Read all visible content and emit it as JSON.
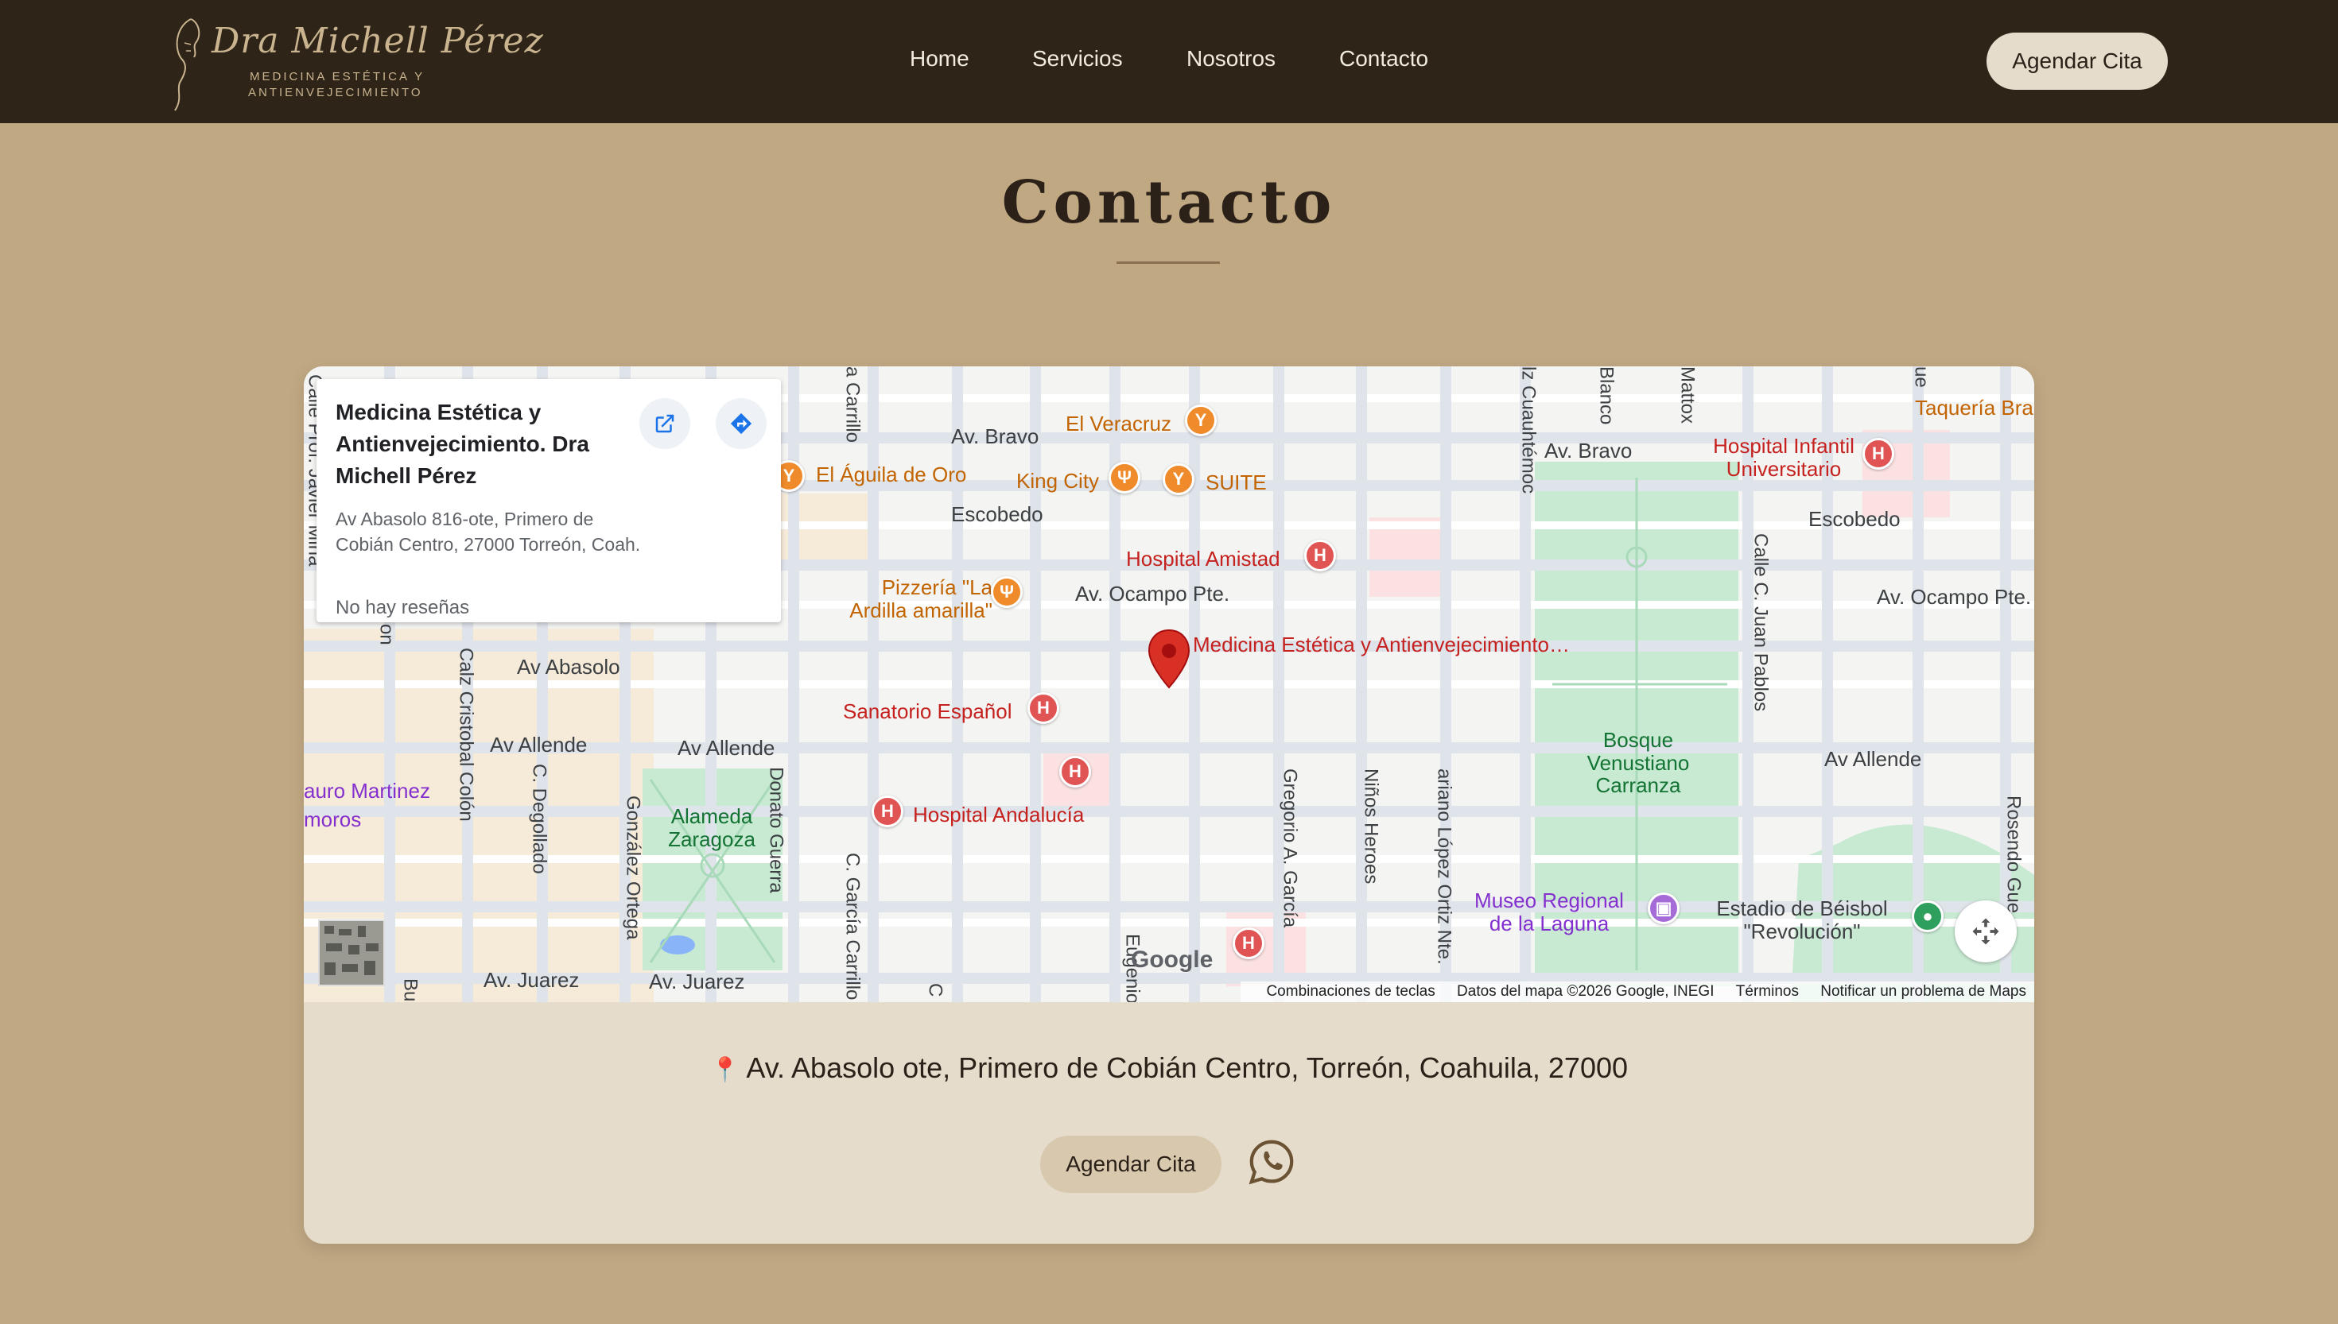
{
  "brand": {
    "script_name": "Dra Michell Pérez",
    "subtitle_line1": "MEDICINA ESTÉTICA Y",
    "subtitle_line2": "ANTIENVEJECIMIENTO"
  },
  "nav": {
    "items": [
      {
        "label": "Home"
      },
      {
        "label": "Servicios"
      },
      {
        "label": "Nosotros"
      },
      {
        "label": "Contacto"
      }
    ],
    "cta_label": "Agendar Cita"
  },
  "page": {
    "title": "Contacto"
  },
  "map": {
    "info": {
      "name": "Medicina Estética y Antienvejecimiento. Dra Michell Pérez",
      "address": "Av Abasolo 816-ote, Primero de Cobián Centro, 27000 Torreón, Coah.",
      "reviews": "No hay reseñas",
      "open_icon": "open-in-new-icon",
      "directions_icon": "directions-icon"
    },
    "streets": {
      "av_bravo_1": "Av. Bravo",
      "av_bravo_2": "Av. Bravo",
      "escobedo_1": "Escobedo",
      "escobedo_2": "Escobedo",
      "av_ocampo_1": "Av. Ocampo Pte.",
      "av_ocampo_2": "Av. Ocampo Pte.",
      "av_abasolo": "Av Abasolo",
      "av_allende_1": "Av Allende",
      "av_allende_2": "Av Allende",
      "av_allende_3": "Av Allende",
      "av_juarez_1": "Av. Juarez",
      "av_juarez_2": "Av. Juarez",
      "calz_colon": "Calz Cristobal Colón",
      "c_degollado": "C. Degollado",
      "gonzalez_ortega": "González Ortega",
      "donato_guerra": "Donato Guerra",
      "c_garcia_carrillo": "C. García Carrillo",
      "carrillo_top": "a Carrillo",
      "gregorio_garcia": "Gregorio A. García",
      "ninos_heroes": "Niños Heroes",
      "lopez_ortiz": "ariano López Ortiz Nte.",
      "cuauhtemoc": "lz Cuauhtémoc",
      "blanco": "Blanco",
      "mattox": "Mattox",
      "juan_pablos": "Calle C. Juan Pablos",
      "rosendo": "Rosendo Gue",
      "eugenio": "Eugenio",
      "calle_top_left": "Calle Prof. Javier Mina",
      "on": "on",
      "bu": "Bu",
      "ue": "ue",
      "c_small": "C"
    },
    "pois": {
      "el_veracruz": "El Veracruz",
      "aguila_de_oro": "El Águila de Oro",
      "king_city": "King City",
      "suite": "SUITE",
      "hospital_amistad": "Hospital Amistad",
      "pizzeria": "Pizzería \"La Ardilla amarilla\"",
      "target": "Medicina Estética y Antienvejecimiento…",
      "sanatorio": "Sanatorio Español",
      "hospital_andalucia": "Hospital Andalucía",
      "hospital_infantil": "Hospital Infantil Universitario",
      "taqueria": "Taquería Bra",
      "bosque": "Bosque Venustiano Carranza",
      "alameda": "Alameda Zaragoza",
      "museo": "Museo Regional de la Laguna",
      "estadio": "Estadio de Béisbol \"Revolución\"",
      "lauro": "auro Martinez",
      "moros": "moros"
    },
    "google_logo": "Google",
    "footer": {
      "shortcuts": "Combinaciones de teclas",
      "map_data": "Datos del mapa ©2026 Google, INEGI",
      "terms": "Términos",
      "report": "Notificar un problema de Maps"
    },
    "colors": {
      "park": "#c8ead3",
      "road": "#ffffff",
      "road_major": "#dfe3ea",
      "tint": "#f6ead8"
    }
  },
  "contact": {
    "address": "Av. Abasolo ote, Primero de Cobián Centro, Torreón, Coahuila, 27000",
    "address_icon": "map-pin-icon",
    "cta_label": "Agendar Cita",
    "whatsapp_icon": "whatsapp-icon"
  },
  "colors": {
    "header_bg": "#2e2418",
    "page_bg": "#c0a883",
    "card_bg": "#e6dccc",
    "accent_gold": "#c9b48f"
  }
}
